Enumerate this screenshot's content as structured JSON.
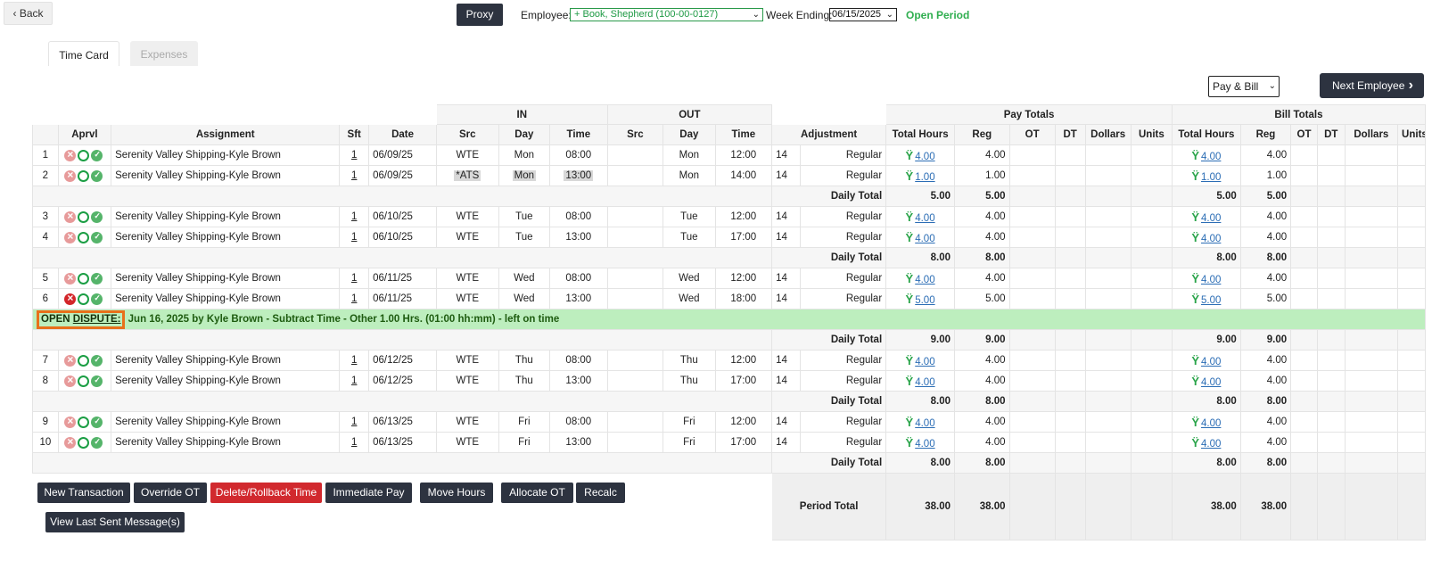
{
  "nav": {
    "back": "‹ Back",
    "proxy": "Proxy"
  },
  "header": {
    "employee_label": "Employee:",
    "employee_value": "+  Book, Shepherd (100-00-0127)",
    "week_label": "Week Ending:",
    "week_value": "06/15/2025",
    "period_status": "Open Period"
  },
  "tabs": [
    "Time Card",
    "Expenses"
  ],
  "view_select": "Pay & Bill",
  "next_employee": "Next Employee",
  "table": {
    "group_in": "IN",
    "group_out": "OUT",
    "group_pay": "Pay Totals",
    "group_bill": "Bill Totals",
    "columns": [
      "Aprvl",
      "Assignment",
      "Sft",
      "Date",
      "Src",
      "Day",
      "Time",
      "Src",
      "Day",
      "Time",
      "Adjustment",
      "Total Hours",
      "Reg",
      "OT",
      "DT",
      "Dollars",
      "Units",
      "Total Hours",
      "Reg",
      "OT",
      "DT",
      "Dollars",
      "Units"
    ],
    "daily_total_label": "Daily Total",
    "period_total_label": "Period Total",
    "period_pay_total": "38.00",
    "period_pay_reg": "38.00",
    "period_bill_total": "38.00",
    "period_bill_reg": "38.00"
  },
  "rows": [
    {
      "n": "1",
      "x": "lite",
      "assign": "Serenity Valley Shipping-Kyle Brown",
      "sft": "1",
      "date": "06/09/25",
      "src": "WTE",
      "inday": "Mon",
      "intime": "08:00",
      "outday": "Mon",
      "outtime": "12:00",
      "code": "14",
      "adj": "Regular",
      "hrs": "4.00",
      "reg": "4.00",
      "bhrs": "4.00",
      "breg": "4.00"
    },
    {
      "n": "2",
      "x": "lite",
      "assign": "Serenity Valley Shipping-Kyle Brown",
      "sft": "1",
      "date": "06/09/25",
      "src": "*ATS",
      "inday": "Mon",
      "intime": "13:00",
      "outday": "Mon",
      "outtime": "14:00",
      "code": "14",
      "adj": "Regular",
      "hrs": "1.00",
      "reg": "1.00",
      "bhrs": "1.00",
      "breg": "1.00",
      "shaded": true
    },
    {
      "daily": true,
      "pay": "5.00",
      "reg": "5.00",
      "bill": "5.00",
      "breg": "5.00"
    },
    {
      "n": "3",
      "x": "lite",
      "assign": "Serenity Valley Shipping-Kyle Brown",
      "sft": "1",
      "date": "06/10/25",
      "src": "WTE",
      "inday": "Tue",
      "intime": "08:00",
      "outday": "Tue",
      "outtime": "12:00",
      "code": "14",
      "adj": "Regular",
      "hrs": "4.00",
      "reg": "4.00",
      "bhrs": "4.00",
      "breg": "4.00"
    },
    {
      "n": "4",
      "x": "lite",
      "assign": "Serenity Valley Shipping-Kyle Brown",
      "sft": "1",
      "date": "06/10/25",
      "src": "WTE",
      "inday": "Tue",
      "intime": "13:00",
      "outday": "Tue",
      "outtime": "17:00",
      "code": "14",
      "adj": "Regular",
      "hrs": "4.00",
      "reg": "4.00",
      "bhrs": "4.00",
      "breg": "4.00"
    },
    {
      "daily": true,
      "pay": "8.00",
      "reg": "8.00",
      "bill": "8.00",
      "breg": "8.00"
    },
    {
      "n": "5",
      "x": "lite",
      "assign": "Serenity Valley Shipping-Kyle Brown",
      "sft": "1",
      "date": "06/11/25",
      "src": "WTE",
      "inday": "Wed",
      "intime": "08:00",
      "outday": "Wed",
      "outtime": "12:00",
      "code": "14",
      "adj": "Regular",
      "hrs": "4.00",
      "reg": "4.00",
      "bhrs": "4.00",
      "breg": "4.00"
    },
    {
      "n": "6",
      "x": "red",
      "assign": "Serenity Valley Shipping-Kyle Brown",
      "sft": "1",
      "date": "06/11/25",
      "src": "WTE",
      "inday": "Wed",
      "intime": "13:00",
      "outday": "Wed",
      "outtime": "18:00",
      "code": "14",
      "adj": "Regular",
      "hrs": "5.00",
      "reg": "5.00",
      "bhrs": "5.00",
      "breg": "5.00"
    },
    {
      "dispute": true,
      "open": "OPEN",
      "link": "DISPUTE:",
      "by": " Jun 16, 2025 by Kyle Brown - ",
      "kind": "Subtract Time - Other  1.00 Hrs.",
      "rest": "  (01:00 hh:mm) - left on time"
    },
    {
      "daily": true,
      "pay": "9.00",
      "reg": "9.00",
      "bill": "9.00",
      "breg": "9.00"
    },
    {
      "n": "7",
      "x": "lite",
      "assign": "Serenity Valley Shipping-Kyle Brown",
      "sft": "1",
      "date": "06/12/25",
      "src": "WTE",
      "inday": "Thu",
      "intime": "08:00",
      "outday": "Thu",
      "outtime": "12:00",
      "code": "14",
      "adj": "Regular",
      "hrs": "4.00",
      "reg": "4.00",
      "bhrs": "4.00",
      "breg": "4.00"
    },
    {
      "n": "8",
      "x": "lite",
      "assign": "Serenity Valley Shipping-Kyle Brown",
      "sft": "1",
      "date": "06/12/25",
      "src": "WTE",
      "inday": "Thu",
      "intime": "13:00",
      "outday": "Thu",
      "outtime": "17:00",
      "code": "14",
      "adj": "Regular",
      "hrs": "4.00",
      "reg": "4.00",
      "bhrs": "4.00",
      "breg": "4.00"
    },
    {
      "daily": true,
      "pay": "8.00",
      "reg": "8.00",
      "bill": "8.00",
      "breg": "8.00"
    },
    {
      "n": "9",
      "x": "lite",
      "assign": "Serenity Valley Shipping-Kyle Brown",
      "sft": "1",
      "date": "06/13/25",
      "src": "WTE",
      "inday": "Fri",
      "intime": "08:00",
      "outday": "Fri",
      "outtime": "12:00",
      "code": "14",
      "adj": "Regular",
      "hrs": "4.00",
      "reg": "4.00",
      "bhrs": "4.00",
      "breg": "4.00"
    },
    {
      "n": "10",
      "x": "lite",
      "assign": "Serenity Valley Shipping-Kyle Brown",
      "sft": "1",
      "date": "06/13/25",
      "src": "WTE",
      "inday": "Fri",
      "intime": "13:00",
      "outday": "Fri",
      "outtime": "17:00",
      "code": "14",
      "adj": "Regular",
      "hrs": "4.00",
      "reg": "4.00",
      "bhrs": "4.00",
      "breg": "4.00"
    },
    {
      "daily": true,
      "pay": "8.00",
      "reg": "8.00",
      "bill": "8.00",
      "breg": "8.00"
    }
  ],
  "buttons": {
    "new_transaction": "New Transaction",
    "override_ot": "Override OT",
    "delete_rollback": "Delete/Rollback Time",
    "immediate_pay": "Immediate Pay",
    "move_hours": "Move Hours",
    "allocate_ot": "Allocate OT",
    "recalc": "Recalc",
    "view_last_sent": "View Last Sent Message(s)"
  },
  "colors": {
    "dark_button": "#2d3340",
    "danger": "#d1292e",
    "open_green": "#2fae4f",
    "dispute_bg": "#bdeebe",
    "dispute_border": "#e8701a",
    "link_blue": "#2b6db5"
  }
}
